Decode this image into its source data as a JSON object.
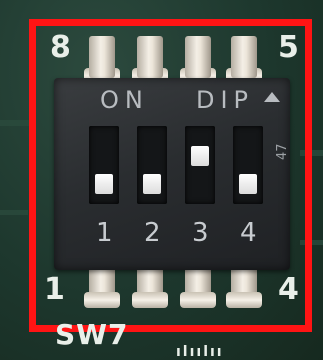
{
  "board": {
    "switch_label": "SW7",
    "pin_labels": {
      "top_left": "8",
      "top_right": "5",
      "bottom_left": "1",
      "bottom_right": "4"
    },
    "bottom_marks": "ılıılıı"
  },
  "dip_switch": {
    "on_text": "ON",
    "dip_text": "DIP",
    "side_code": "47",
    "switches": [
      {
        "number": "1",
        "state": "off"
      },
      {
        "number": "2",
        "state": "off"
      },
      {
        "number": "3",
        "state": "on"
      },
      {
        "number": "4",
        "state": "off"
      }
    ]
  },
  "colors": {
    "highlight": "#ff1414",
    "pcb": "#1f3a30",
    "switch_body": "#2a2d30"
  }
}
